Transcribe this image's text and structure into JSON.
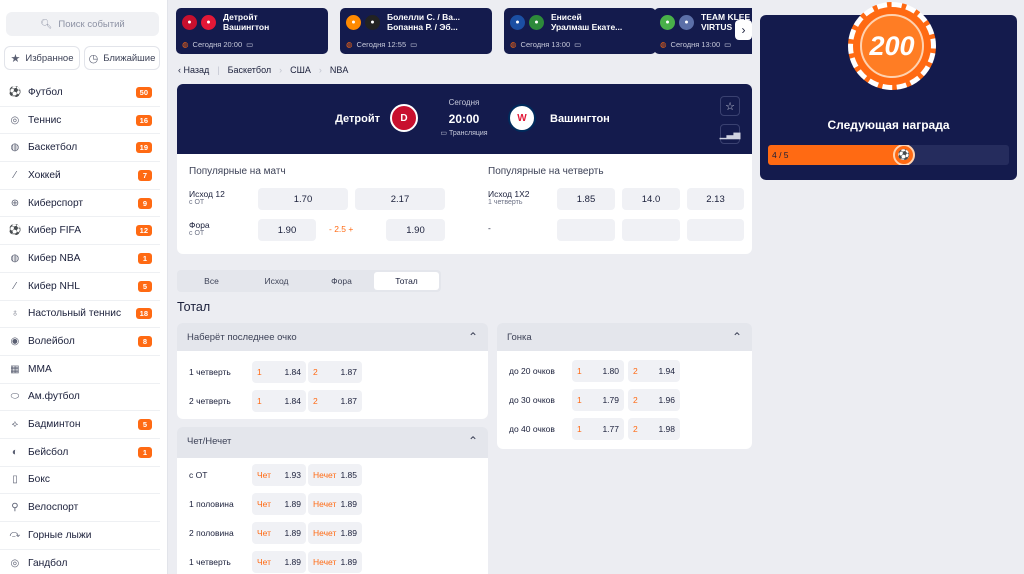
{
  "sidebar": {
    "search_placeholder": "Поиск событий",
    "fav_label": "Избранное",
    "near_label": "Ближайшие",
    "sports": [
      {
        "name": "Футбол",
        "count": "50",
        "icon": "soccer-ball-icon",
        "glyph": "⚽"
      },
      {
        "name": "Теннис",
        "count": "16",
        "icon": "tennis-ball-icon",
        "glyph": "◎"
      },
      {
        "name": "Баскетбол",
        "count": "19",
        "icon": "basketball-icon",
        "glyph": "◍"
      },
      {
        "name": "Хоккей",
        "count": "7",
        "icon": "hockey-stick-icon",
        "glyph": "⁄"
      },
      {
        "name": "Киберспорт",
        "count": "9",
        "icon": "gamepad-icon",
        "glyph": "⊕"
      },
      {
        "name": "Кибер FIFA",
        "count": "12",
        "icon": "cyber-fifa-icon",
        "glyph": "⚽"
      },
      {
        "name": "Кибер NBA",
        "count": "1",
        "icon": "cyber-nba-icon",
        "glyph": "◍"
      },
      {
        "name": "Кибер NHL",
        "count": "5",
        "icon": "cyber-nhl-icon",
        "glyph": "⁄"
      },
      {
        "name": "Настольный теннис",
        "count": "18",
        "icon": "table-tennis-icon",
        "glyph": "♁"
      },
      {
        "name": "Волейбол",
        "count": "8",
        "icon": "volleyball-icon",
        "glyph": "◉"
      },
      {
        "name": "MMA",
        "count": "",
        "icon": "mma-cage-icon",
        "glyph": "▦"
      },
      {
        "name": "Ам.футбол",
        "count": "",
        "icon": "american-football-icon",
        "glyph": "⬭"
      },
      {
        "name": "Бадминтон",
        "count": "5",
        "icon": "shuttlecock-icon",
        "glyph": "⟡"
      },
      {
        "name": "Бейсбол",
        "count": "1",
        "icon": "baseball-icon",
        "glyph": "◐"
      },
      {
        "name": "Бокс",
        "count": "",
        "icon": "boxing-glove-icon",
        "glyph": "▯"
      },
      {
        "name": "Велоспорт",
        "count": "",
        "icon": "bicycle-icon",
        "glyph": "⚲"
      },
      {
        "name": "Горные лыжи",
        "count": "",
        "icon": "skier-icon",
        "glyph": "⤼"
      },
      {
        "name": "Гандбол",
        "count": "",
        "icon": "handball-icon",
        "glyph": "◎"
      }
    ]
  },
  "ticker": [
    {
      "t1": "Детройт",
      "t2": "Вашингтон",
      "time": "Сегодня 20:00",
      "c1": "#c8102e",
      "c2": "#e31837"
    },
    {
      "t1": "Болелли С. / Ва...",
      "t2": "Бопанна Р. / Эб...",
      "time": "Сегодня 12:55",
      "c1": "#ff8a00",
      "c2": "#222222"
    },
    {
      "t1": "Енисей",
      "t2": "Уралмаш Екате...",
      "time": "Сегодня 13:00",
      "c1": "#1b4fa3",
      "c2": "#2d8a3a"
    },
    {
      "t1": "TEAM KLEE",
      "t2": "VIRTUS",
      "time": "Сегодня 13:00",
      "c1": "#49b049",
      "c2": "#5b6fa8"
    }
  ],
  "breadcrumb": {
    "back": "Назад",
    "items": [
      "Баскетбол",
      "США",
      "NBA"
    ]
  },
  "match": {
    "home": "Детройт",
    "away": "Вашингтон",
    "day": "Сегодня",
    "time": "20:00",
    "broadcast": "Трансляция"
  },
  "popular_match": {
    "title": "Популярные на матч",
    "rows": [
      {
        "label": "Исход 12",
        "sub": "с ОТ",
        "a": "1.70",
        "b": "2.17",
        "mid": ""
      },
      {
        "label": "Фора",
        "sub": "с ОТ",
        "a": "1.90",
        "b": "1.90",
        "mid": "- 2.5 +"
      }
    ]
  },
  "popular_quarter": {
    "title": "Популярные на четверть",
    "rows": [
      {
        "label": "Исход 1X2",
        "sub": "1 четверть",
        "a": "1.85",
        "b": "14.0",
        "c": "2.13"
      },
      {
        "label": "-",
        "sub": "",
        "a": "",
        "b": "",
        "c": ""
      }
    ]
  },
  "tabs": [
    "Все",
    "Исход",
    "Фора",
    "Тотал"
  ],
  "section_title": "Тотал",
  "last_point": {
    "title": "Наберёт последнее очко",
    "rows": [
      {
        "label": "1 четверть",
        "k1": "1",
        "v1": "1.84",
        "k2": "2",
        "v2": "1.87"
      },
      {
        "label": "2 четверть",
        "k1": "1",
        "v1": "1.84",
        "k2": "2",
        "v2": "1.87"
      }
    ]
  },
  "race": {
    "title": "Гонка",
    "rows": [
      {
        "label": "до 20 очков",
        "k1": "1",
        "v1": "1.80",
        "k2": "2",
        "v2": "1.94"
      },
      {
        "label": "до 30 очков",
        "k1": "1",
        "v1": "1.79",
        "k2": "2",
        "v2": "1.96"
      },
      {
        "label": "до 40 очков",
        "k1": "1",
        "v1": "1.77",
        "k2": "2",
        "v2": "1.98"
      }
    ]
  },
  "odd_even": {
    "title": "Чет/Нечет",
    "rows": [
      {
        "label": "с ОТ",
        "k1": "Чет",
        "v1": "1.93",
        "k2": "Нечет",
        "v2": "1.85"
      },
      {
        "label": "1 половина",
        "k1": "Чет",
        "v1": "1.89",
        "k2": "Нечет",
        "v2": "1.89"
      },
      {
        "label": "2 половина",
        "k1": "Чет",
        "v1": "1.89",
        "k2": "Нечет",
        "v2": "1.89"
      },
      {
        "label": "1 четверть",
        "k1": "Чет",
        "v1": "1.89",
        "k2": "Нечет",
        "v2": "1.89"
      }
    ]
  },
  "promo": {
    "chip_value": "200",
    "title": "Следующая награда",
    "progress_text": "4 / 5",
    "progress_fraction": 0.8
  },
  "colors": {
    "navy": "#141b4d",
    "accent": "#ff6a13"
  }
}
